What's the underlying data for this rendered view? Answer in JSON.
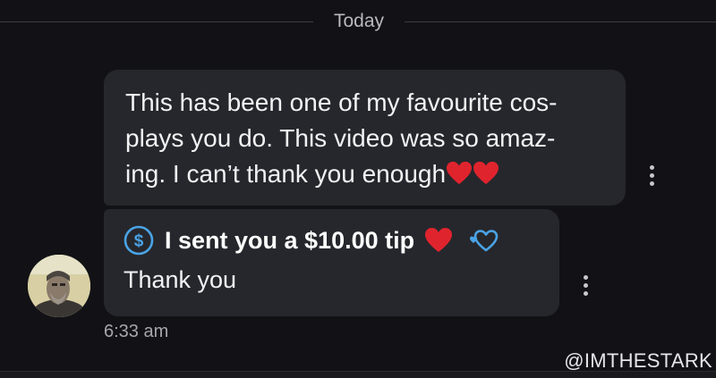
{
  "date_separator": "Today",
  "message1": {
    "line1": "This has been one of my favourite cos-",
    "line2": "plays you do. This video was so amaz-",
    "line3": "ing. I can’t thank you enough"
  },
  "message2": {
    "tip_text": "I sent you a $10.00 tip",
    "body": "Thank you"
  },
  "timestamp": "6:33 am",
  "watermark": "@IMTHESTARK",
  "icons": {
    "dollar": "dollar-circle-icon",
    "heart": "red-heart-icon",
    "outline_heart": "heart-outline-icon",
    "menu": "more-vertical-icon"
  },
  "colors": {
    "background": "#121216",
    "bubble": "#26272c",
    "accent_blue": "#4aa3e6",
    "heart_red": "#e0242e"
  }
}
